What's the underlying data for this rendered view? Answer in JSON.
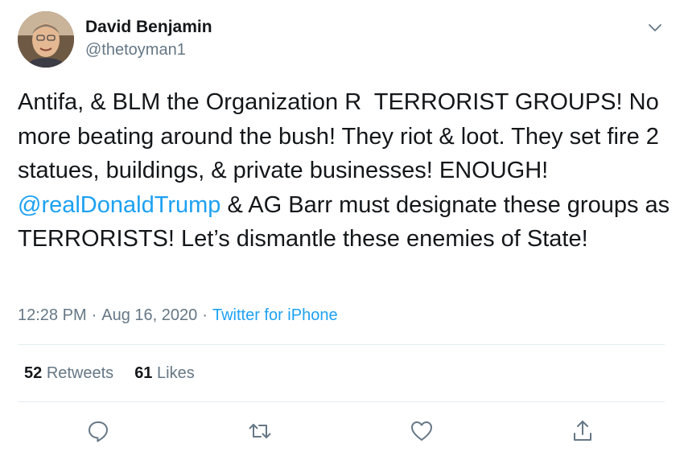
{
  "author": {
    "display_name": "David Benjamin",
    "handle": "@thetoyman1",
    "avatar_icon": "profile-avatar"
  },
  "tweet": {
    "text_part1": "Antifa, & BLM the Organization R  TERRORIST GROUPS! No more beating around the bush! They riot & loot. They set fire 2 statues, buildings, & private businesses! ENOUGH! ",
    "mention": "@realDonaldTrump",
    "text_part2": " & AG Barr must designate these groups as TERRORISTS! Let’s dismantle these enemies of State!"
  },
  "meta": {
    "time": "12:28 PM",
    "separator": "·",
    "date": "Aug 16, 2020",
    "source": "Twitter for iPhone"
  },
  "stats": {
    "retweets_count": "52",
    "retweets_label": "Retweets",
    "likes_count": "61",
    "likes_label": "Likes"
  },
  "actions": [
    "reply-icon",
    "retweet-icon",
    "like-icon",
    "share-icon"
  ],
  "colors": {
    "text": "#14171a",
    "secondary": "#657786",
    "accent": "#1da1f2",
    "divider": "#e6ecf0"
  }
}
